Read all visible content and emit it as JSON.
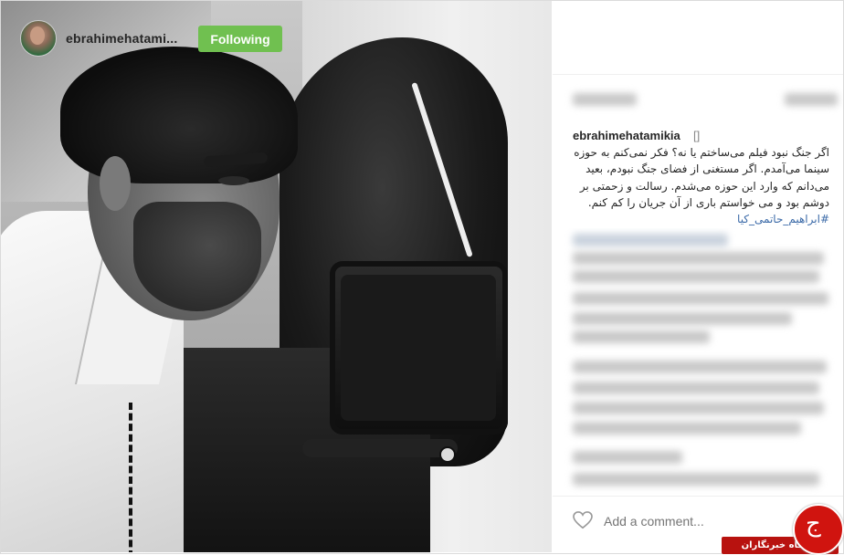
{
  "post": {
    "username": "ebrahimehatami...",
    "follow_label": "Following",
    "caption_username": "ebrahimehatamikia",
    "caption_box": "[]",
    "caption_lines": [
      "اگر جنگ نبود فیلم می‌ساختم یا نه؟ فکر نمی‌کنم به حوزه",
      "سینما می‌آمدم. اگر مستغنی از فضای جنگ نبودم، بعید",
      "می‌دانم که وارد این حوزه می‌شدم. رسالت و زحمتی بر",
      "دوشم بود و می خواستم باری از آن جریان را کم کنم."
    ],
    "hashtag": "#ابراهیم_حاتمی_کیا",
    "add_comment_placeholder": "Add a comment..."
  },
  "watermark": {
    "label": "باشگاه خبرنگاران",
    "glyph": "ج"
  },
  "colors": {
    "follow_button": "#70c050",
    "hashtag": "#3b6aa8",
    "watermark": "#b8120f"
  }
}
